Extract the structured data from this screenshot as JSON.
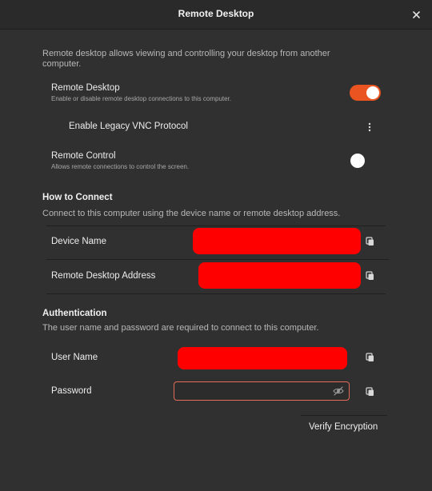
{
  "window": {
    "title": "Remote Desktop"
  },
  "intro": {
    "description": "Remote desktop allows viewing and controlling your desktop from another computer."
  },
  "remote_desktop": {
    "label": "Remote Desktop",
    "sublabel": "Enable or disable remote desktop connections to this computer.",
    "enabled": true
  },
  "legacy_vnc": {
    "label": "Enable Legacy VNC Protocol"
  },
  "remote_control": {
    "label": "Remote Control",
    "sublabel": "Allows remote connections to control the screen.",
    "enabled": false
  },
  "how_to_connect": {
    "title": "How to Connect",
    "description": "Connect to this computer using the device name or remote desktop address.",
    "rows": [
      {
        "label": "Device Name"
      },
      {
        "label": "Remote Desktop Address"
      }
    ]
  },
  "authentication": {
    "title": "Authentication",
    "description": "The user name and password are required to connect to this computer.",
    "user_name_label": "User Name",
    "password_label": "Password"
  },
  "actions": {
    "verify_encryption": "Verify Encryption"
  },
  "colors": {
    "accent": "#e95420",
    "redaction": "#ff0000",
    "password_border": "#e36b58",
    "background": "#303030"
  },
  "icons": {
    "close": "close-icon",
    "more": "vertical-dots-icon",
    "copy": "copy-icon",
    "reveal": "eye-off-icon"
  }
}
